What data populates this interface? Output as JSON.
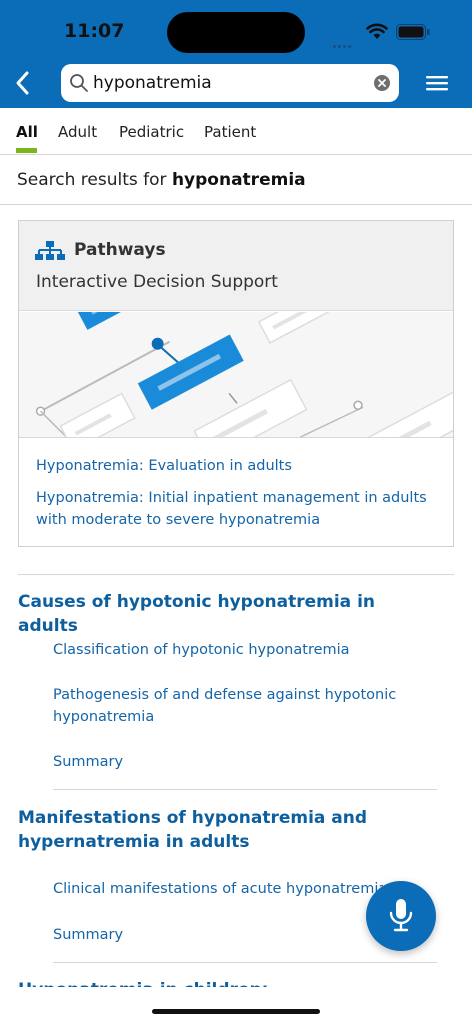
{
  "status_bar": {
    "time": "11:07"
  },
  "search": {
    "value": "hyponatremia",
    "placeholder": ""
  },
  "icons": {
    "back": "chevron-left-icon",
    "search": "search-icon",
    "clear": "clear-icon",
    "menu": "hamburger-menu-icon",
    "pathways": "org-chart-icon",
    "mic": "microphone-icon"
  },
  "colors": {
    "brand": "#0b6cb8",
    "link": "#1565a8",
    "section_title": "#0d5f9e",
    "tab_indicator": "#7ab51d"
  },
  "tabs": [
    {
      "label": "All",
      "active": true
    },
    {
      "label": "Adult",
      "active": false
    },
    {
      "label": "Pediatric",
      "active": false
    },
    {
      "label": "Patient",
      "active": false
    }
  ],
  "results": {
    "prefix": "Search results for ",
    "query": "hyponatremia"
  },
  "pathways_card": {
    "title": "Pathways",
    "subtitle": "Interactive Decision Support",
    "links": [
      "Hyponatremia: Evaluation in adults",
      "Hyponatremia: Initial inpatient management in adults with moderate to severe hyponatremia"
    ]
  },
  "sections": [
    {
      "title": "Causes of hypotonic hyponatremia in adults",
      "links": [
        "Classification of hypotonic hyponatremia",
        "Pathogenesis of and defense against hypotonic hyponatremia",
        "Summary"
      ]
    },
    {
      "title": "Manifestations of hyponatremia and hypernatremia in adults",
      "links": [
        "Clinical manifestations of acute hyponatremia",
        "Summary"
      ]
    },
    {
      "title": "Hyponatremia in children: Evaluation",
      "links": []
    }
  ]
}
